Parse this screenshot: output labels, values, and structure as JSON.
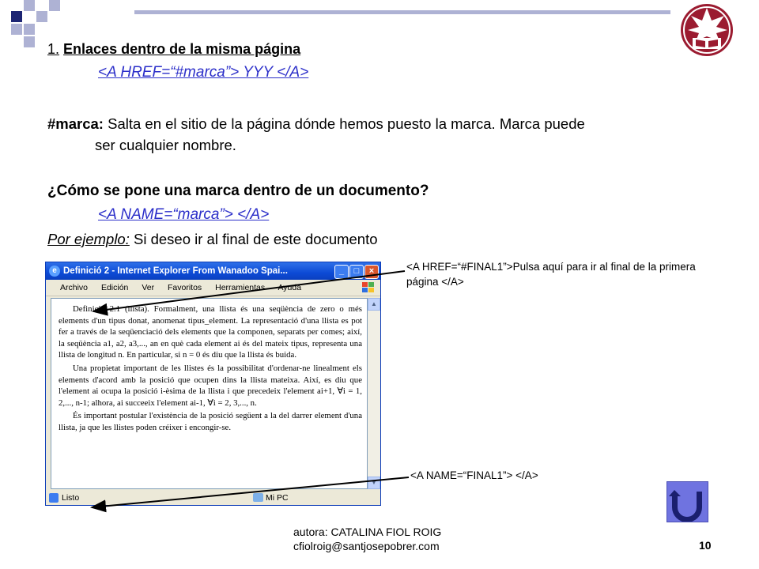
{
  "title": {
    "number": "1.",
    "text": "Enlaces dentro de la misma página"
  },
  "code": {
    "href": "<A HREF=“#marca”> YYY </A>",
    "name": "<A NAME=“marca”> </A>"
  },
  "para": {
    "term": "#marca:",
    "line1": " Salta en el sitio de la página dónde hemos puesto la marca. Marca puede",
    "line2": "ser cualquier nombre."
  },
  "question": "¿Cómo se pone una marca dentro de un documento?",
  "example": {
    "label": "Por ejemplo:",
    "text": " Si deseo ir al final de este documento"
  },
  "browser": {
    "title": "Definició 2 - Internet Explorer From Wanadoo Spai...",
    "menu": [
      "Archivo",
      "Edición",
      "Ver",
      "Favoritos",
      "Herramientas",
      "Ayuda"
    ],
    "paragraphs": [
      "Definició 2.1 (llista). Formalment, una llista és una seqüència de zero o més elements d'un tipus donat, anomenat tipus_element. La representació d'una llista es pot fer a través de la seqüenciació dels elements que la componen, separats per comes; així, la seqüència a1, a2, a3,..., an en què cada element ai és del mateix tipus, representa una llista de longitud n. En particular, si n = 0 és diu que la llista és buida.",
      "Una propietat important de les llistes és la possibilitat d'ordenar-ne linealment els elements d'acord amb la posició que ocupen dins la llista mateixa. Així, es diu que l'element ai ocupa la posició i-èsima de la llista i que precedeix l'element ai+1, ∀i = 1, 2,..., n-1; alhora, ai succeeix l'element ai-1, ∀i = 2, 3,..., n.",
      "És important postular l'existència de la posició següent a la del darrer element d'una llista, ja que les llistes poden créixer i encongir-se."
    ],
    "status_left": "Listo",
    "status_right": "Mi PC"
  },
  "annotations": {
    "href_note": "<A HREF=“#FINAL1”>Pulsa aquí para ir al final de la primera página </A>",
    "name_note": "<A NAME=“FINAL1”> </A>"
  },
  "footer": {
    "line1": "autora: CATALINA FIOL ROIG",
    "line2": "cfiolroig@santjosepobrer.com"
  },
  "page_number": "10",
  "colors": {
    "code": "#2b2ec9",
    "accent_squares": "#1c2473",
    "light_squares": "#aeb2d4",
    "logo_red": "#9b1b30",
    "back_button": "#6f73e0"
  },
  "icons": [
    "ie-icon",
    "windows-logo-icon",
    "page-icon",
    "computer-icon",
    "u-turn-back-icon"
  ]
}
